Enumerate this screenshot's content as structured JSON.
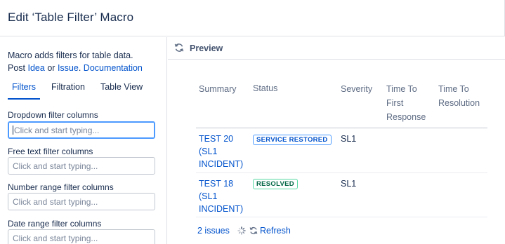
{
  "dialog": {
    "title": "Edit ‘Table Filter’ Macro"
  },
  "sidebar": {
    "description_prefix": "Macro adds filters for table data.",
    "post_label": "Post",
    "idea_link": "Idea",
    "or_label": "or",
    "issue_link": "Issue",
    "period": ".",
    "documentation_link": "Documentation",
    "tabs": [
      {
        "label": "Filters",
        "active": true
      },
      {
        "label": "Filtration",
        "active": false
      },
      {
        "label": "Table View",
        "active": false
      }
    ],
    "fields": [
      {
        "label": "Dropdown filter columns",
        "placeholder": "Click and start typing...",
        "focused": true
      },
      {
        "label": "Free text filter columns",
        "placeholder": "Click and start typing...",
        "focused": false
      },
      {
        "label": "Number range filter columns",
        "placeholder": "Click and start typing...",
        "focused": false
      },
      {
        "label": "Date range filter columns",
        "placeholder": "Click and start typing...",
        "focused": false
      }
    ]
  },
  "preview": {
    "label": "Preview",
    "icon": "refresh-icon",
    "columns": {
      "summary": "Summary",
      "status": "Status",
      "severity": "Severity",
      "ttfr": [
        "Time To",
        "First",
        "Response"
      ],
      "ttr": [
        "Time To",
        "Resolution"
      ]
    },
    "rows": [
      {
        "summary": [
          "TEST 20",
          "(SL1",
          "INCIDENT)"
        ],
        "status": "SERVICE RESTORED",
        "status_color": "#0052cc",
        "severity": "SL1"
      },
      {
        "summary": [
          "TEST 18",
          "(SL1",
          "INCIDENT)"
        ],
        "status": "RESOLVED",
        "status_color": "#006644",
        "severity": "SL1"
      }
    ],
    "footer": {
      "count": "2 issues",
      "refresh": "Refresh"
    }
  },
  "colors": {
    "link": "#0052cc",
    "text": "#172b4d",
    "border": "#dfe1e6"
  }
}
